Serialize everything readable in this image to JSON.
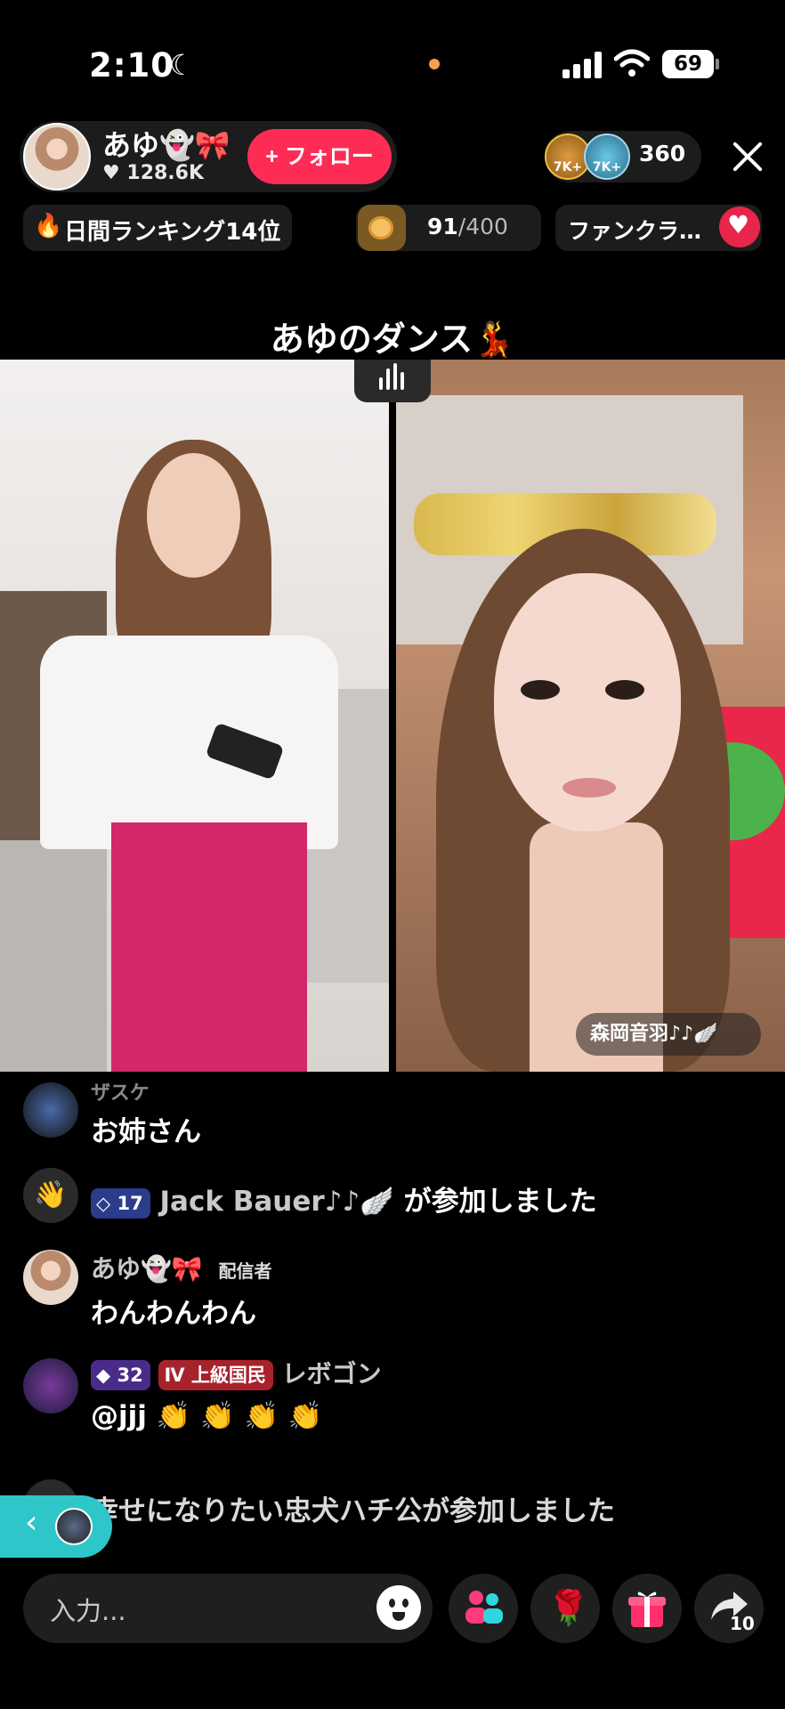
{
  "status_bar": {
    "time": "2:10",
    "battery": "69"
  },
  "host": {
    "name": "あゆ👻🎀",
    "likes": "♥ 128.6K",
    "follow_label": "+ フォロー"
  },
  "viewers": {
    "count": "360",
    "top_badges": [
      "7K+",
      "7K+"
    ]
  },
  "ranking": {
    "label": "日間ランキング14位"
  },
  "goal": {
    "current": "91",
    "total": "/400"
  },
  "fan_club": {
    "label": "ファンクラ…"
  },
  "stream_title": "あゆのダンス💃",
  "guest": {
    "name": "森岡音羽♪♪🪽"
  },
  "chat": [
    {
      "type": "message",
      "name": "ザスケ",
      "text": "お姉さん"
    },
    {
      "type": "join",
      "level": "17",
      "name": "Jack Bauer♪♪🪽",
      "text": "が参加しました"
    },
    {
      "type": "message",
      "name": "あゆ👻🎀",
      "role": "配信者",
      "text": "わんわんわん"
    },
    {
      "type": "message",
      "level": "32",
      "rank": "上級国民",
      "rank_level": "Ⅳ",
      "name": "レボゴン",
      "text": "@jjj 👏 👏 👏 👏"
    },
    {
      "type": "join",
      "text": "幸せになりたい忠犬ハチ公が参加しました"
    }
  ],
  "input": {
    "placeholder": "入力..."
  },
  "share": {
    "count": "10"
  },
  "colors": {
    "accent": "#fe2c55",
    "teal_tab": "#2fc6c9",
    "background": "#000000"
  }
}
